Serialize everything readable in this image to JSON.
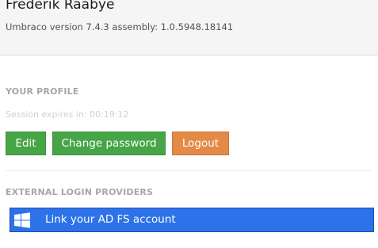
{
  "header": {
    "user_name": "Frederik Raabye",
    "version_text": "Umbraco version 7.4.3 assembly: 1.0.5948.18141"
  },
  "profile": {
    "section_title": "YOUR PROFILE",
    "session_text": "Session expires in: 00:19:12",
    "buttons": {
      "edit_label": "Edit",
      "change_password_label": "Change password",
      "logout_label": "Logout"
    }
  },
  "external_logins": {
    "section_title": "EXTERNAL LOGIN PROVIDERS",
    "providers": [
      {
        "label": "Link your AD FS account",
        "icon": "windows-icon"
      }
    ]
  },
  "colors": {
    "success_button": "#46a546",
    "warning_button": "#e38a46",
    "provider_button": "#2d72e8"
  }
}
